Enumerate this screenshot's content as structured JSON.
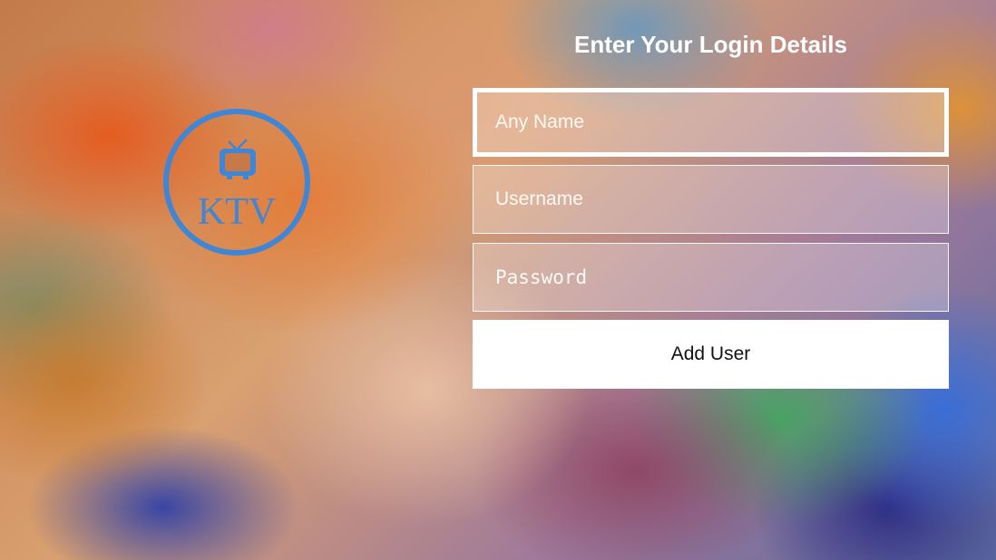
{
  "logo": {
    "text": "KTV",
    "icon": "tv-icon",
    "color": "#3f86d6"
  },
  "login": {
    "title": "Enter Your Login Details",
    "any_name_placeholder": "Any Name",
    "username_placeholder": "Username",
    "password_placeholder": "Password",
    "add_user_label": "Add User"
  }
}
